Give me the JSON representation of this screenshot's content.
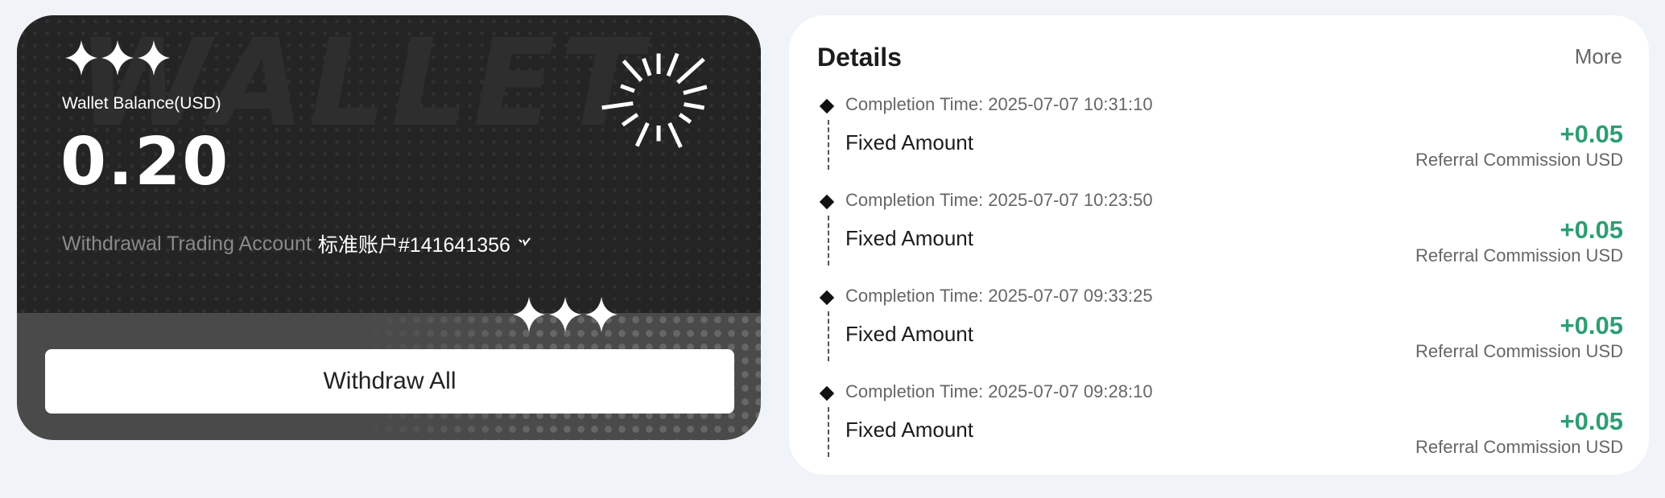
{
  "wallet": {
    "watermark": "WALLET",
    "balance_label": "Wallet Balance(USD)",
    "balance_value": "0.20",
    "account_label": "Withdrawal Trading Account",
    "account_value": "标准账户#141641356",
    "chevron_icon": "chevron-down-icon",
    "withdraw_button": "Withdraw All",
    "accent_dark": "#242424"
  },
  "details": {
    "title": "Details",
    "more_label": "More",
    "amount_color": "#2e9e72",
    "records": [
      {
        "time": "Completion Time: 2025-07-07 10:31:10",
        "type": "Fixed Amount",
        "amount": "+0.05",
        "sub": "Referral Commission USD"
      },
      {
        "time": "Completion Time: 2025-07-07 10:23:50",
        "type": "Fixed Amount",
        "amount": "+0.05",
        "sub": "Referral Commission USD"
      },
      {
        "time": "Completion Time: 2025-07-07 09:33:25",
        "type": "Fixed Amount",
        "amount": "+0.05",
        "sub": "Referral Commission USD"
      },
      {
        "time": "Completion Time: 2025-07-07 09:28:10",
        "type": "Fixed Amount",
        "amount": "+0.05",
        "sub": "Referral Commission USD"
      }
    ]
  }
}
